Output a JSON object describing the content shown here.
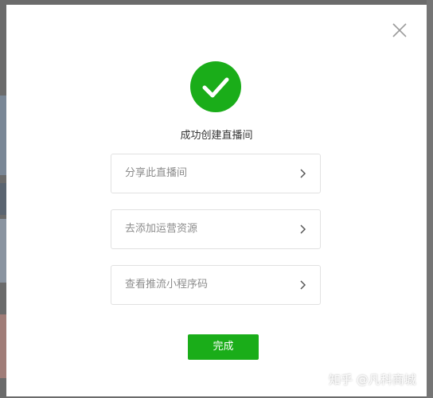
{
  "dialog": {
    "title": "成功创建直播间",
    "options": [
      {
        "label": "分享此直播间"
      },
      {
        "label": "去添加运营资源"
      },
      {
        "label": "查看推流小程序码"
      }
    ],
    "done_label": "完成"
  },
  "icons": {
    "close": "close-icon",
    "success": "check-circle-icon",
    "chevron": "chevron-right-icon"
  },
  "colors": {
    "accent": "#1aad19",
    "border": "#e1e1e1",
    "option_text": "#8c8c8c"
  },
  "watermark": "知乎 @凡科商城"
}
